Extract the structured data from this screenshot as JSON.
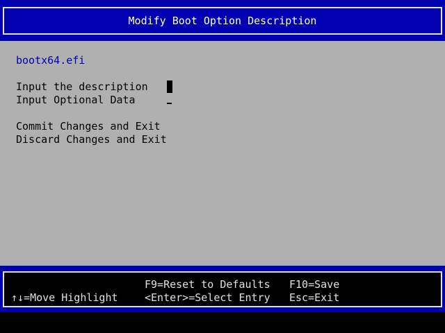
{
  "header": {
    "title": "Modify Boot Option Description"
  },
  "main": {
    "file_name": "bootx64.efi",
    "fields": [
      {
        "label": "Input the description"
      },
      {
        "label": "Input Optional Data"
      }
    ],
    "actions": [
      {
        "label": "Commit Changes and Exit"
      },
      {
        "label": "Discard Changes and Exit"
      }
    ]
  },
  "footer": {
    "move_highlight": "↑↓=Move Highlight",
    "reset_defaults": "F9=Reset to Defaults",
    "select_entry": "<Enter>=Select Entry",
    "save": "F10=Save",
    "exit": "Esc=Exit"
  },
  "colors": {
    "bios_blue": "#0000b0",
    "panel_gray": "#b0b0b0",
    "text_white": "#ffffff",
    "text_black": "#000000"
  }
}
